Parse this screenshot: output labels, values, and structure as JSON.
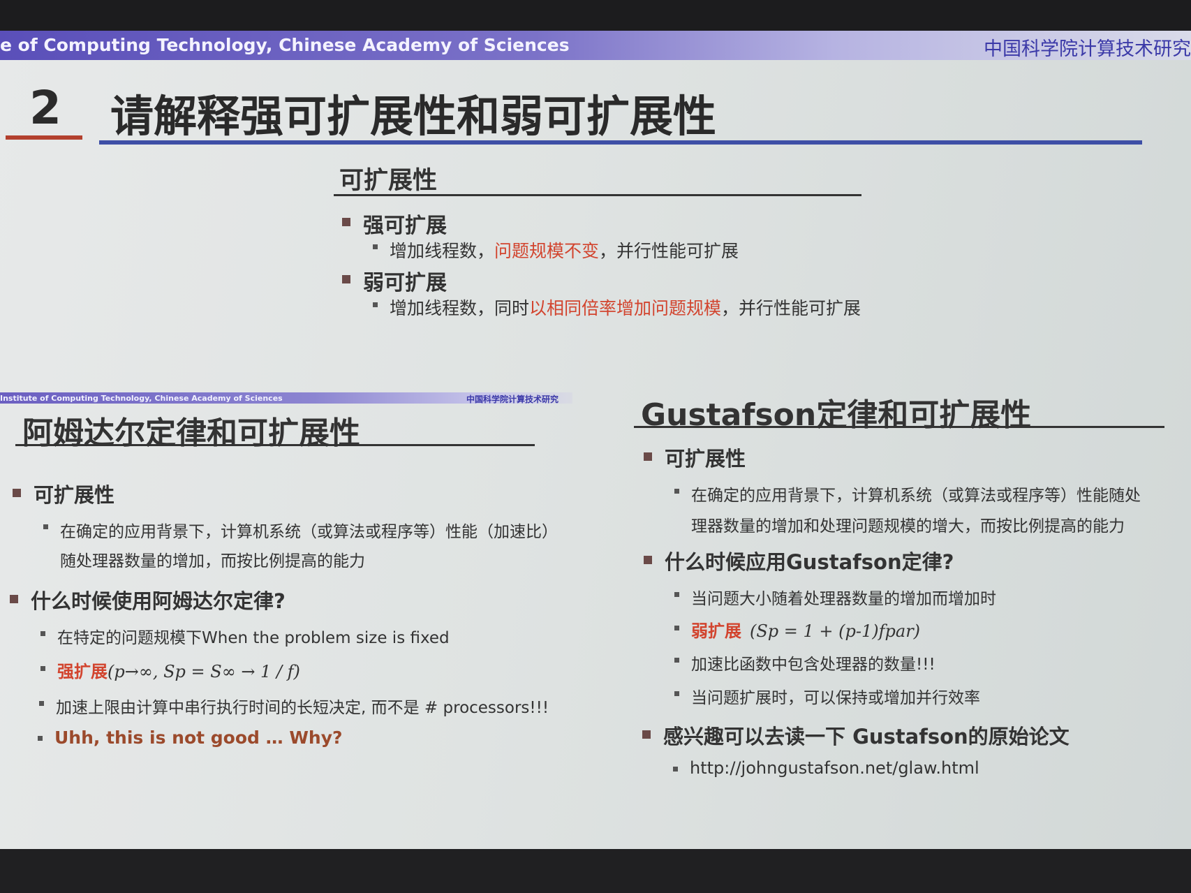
{
  "header": {
    "institute_en": "e of Computing Technology, Chinese Academy of Sciences",
    "institute_cn": "中国科学院计算技术研究"
  },
  "title": {
    "number": "2",
    "text": "请解释强可扩展性和弱可扩展性"
  },
  "scalability": {
    "heading": "可扩展性",
    "strong": {
      "label": "强可扩展",
      "pre": "增加线程数，",
      "highlight": "问题规模不变",
      "post": "，并行性能可扩展"
    },
    "weak": {
      "label": "弱可扩展",
      "pre": "增加线程数，同时",
      "highlight": "以相同倍率增加问题规模",
      "post": "，并行性能可扩展"
    }
  },
  "amdahl": {
    "header_en": "Institute of Computing Technology, Chinese Academy of Sciences",
    "header_cn": "中国科学院计算技术研究",
    "title": "阿姆达尔定律和可扩展性",
    "b1": "可扩展性",
    "b1_s1_line1": "在确定的应用背景下，计算机系统（或算法或程序等）性能（加速比）",
    "b1_s1_line2": "随处理器数量的增加，而按比例提高的能力",
    "b2": "什么时候使用阿姆达尔定律?",
    "b2_s1": "在特定的问题规模下When the problem size is fixed",
    "b2_s2_label": "强扩展",
    "b2_s2_formula": "(p→∞, Sp = S∞ → 1 / f)",
    "b2_s3": "加速上限由计算中串行执行时间的长短决定, 而不是 # processors!!!",
    "b2_s4": "Uhh, this is not good … Why?"
  },
  "gustafson": {
    "title": "Gustafson定律和可扩展性",
    "b1": "可扩展性",
    "b1_s1_line1": "在确定的应用背景下，计算机系统（或算法或程序等）性能随处",
    "b1_s1_line2": "理器数量的增加和处理问题规模的增大，而按比例提高的能力",
    "b2": "什么时候应用Gustafson定律?",
    "b2_s1": "当问题大小随着处理器数量的增加而增加时",
    "b2_s2_label": "弱扩展",
    "b2_s2_formula": "(Sp = 1 + (p-1)fpar)",
    "b2_s3": "加速比函数中包含处理器的数量!!!",
    "b2_s4": "当问题扩展时，可以保持或增加并行效率",
    "b3": "感兴趣可以去读一下 Gustafson的原始论文",
    "b3_s1": "http://johngustafson.net/glaw.html"
  },
  "colors": {
    "accent_blue": "#3e4fa6",
    "accent_red": "#b3402e",
    "highlight": "#d2442e"
  }
}
